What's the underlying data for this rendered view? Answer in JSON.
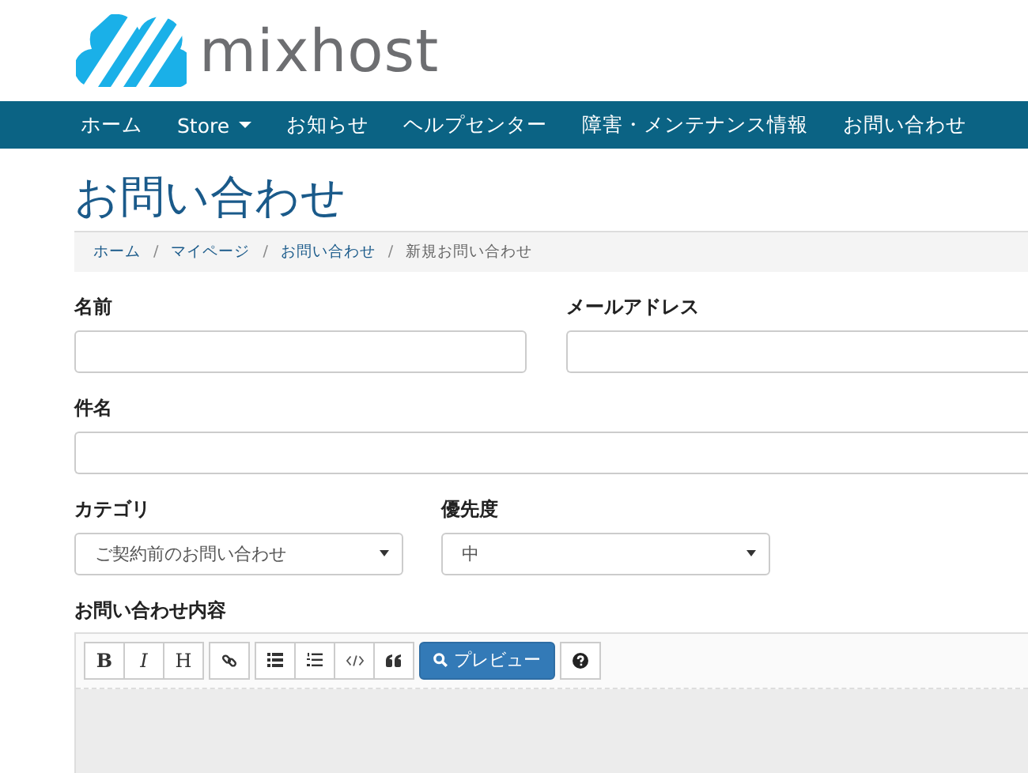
{
  "logo": {
    "text": "mixhost"
  },
  "nav": [
    {
      "label": "ホーム",
      "dropdown": false
    },
    {
      "label": "Store",
      "dropdown": true
    },
    {
      "label": "お知らせ",
      "dropdown": false
    },
    {
      "label": "ヘルプセンター",
      "dropdown": false
    },
    {
      "label": "障害・メンテナンス情報",
      "dropdown": false
    },
    {
      "label": "お問い合わせ",
      "dropdown": false
    }
  ],
  "page_title": "お問い合わせ",
  "breadcrumb": [
    {
      "label": "ホーム",
      "current": false
    },
    {
      "label": "マイページ",
      "current": false
    },
    {
      "label": "お問い合わせ",
      "current": false
    },
    {
      "label": "新規お問い合わせ",
      "current": true
    }
  ],
  "breadcrumb_separator": "/",
  "form": {
    "name_label": "名前",
    "email_label": "メールアドレス",
    "subject_label": "件名",
    "category": {
      "label": "カテゴリ",
      "value": "ご契約前のお問い合わせ"
    },
    "priority": {
      "label": "優先度",
      "value": "中"
    },
    "message_label": "お問い合わせ内容"
  },
  "editor_toolbar": [
    [
      {
        "kind": "bold",
        "text": "B"
      },
      {
        "kind": "italic",
        "text": "I"
      },
      {
        "kind": "heading",
        "text": "H"
      }
    ],
    [
      {
        "kind": "link"
      }
    ],
    [
      {
        "kind": "bullets"
      },
      {
        "kind": "numbers"
      },
      {
        "kind": "code"
      },
      {
        "kind": "quote"
      }
    ],
    [
      {
        "kind": "preview",
        "text": "プレビュー"
      }
    ],
    [
      {
        "kind": "help"
      }
    ]
  ]
}
